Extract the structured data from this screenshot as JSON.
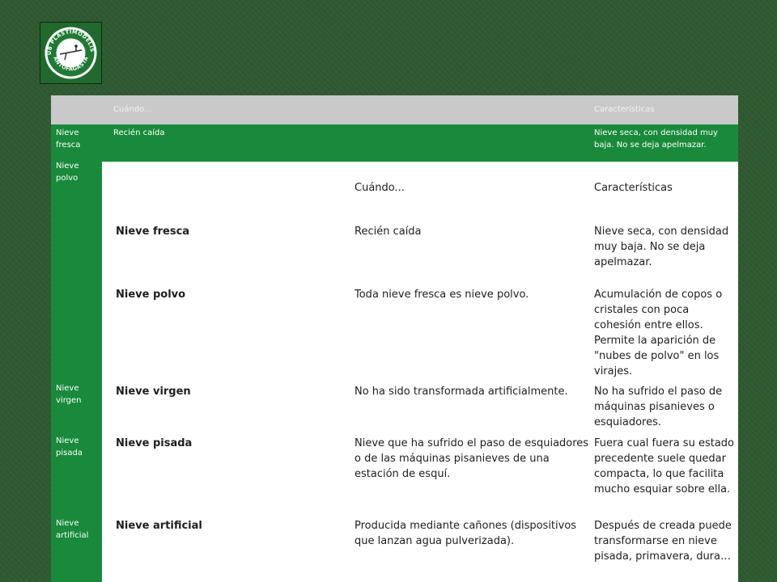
{
  "logo": {
    "text_top": "CLUB PLASTIMODELISMO",
    "text_bottom": "ANTOFAGASTA"
  },
  "header": {
    "col_when": "Cuándo...",
    "col_chars": "Características"
  },
  "ghost_rows": [
    {
      "name": "Nieve fresca",
      "when": "Recién caída",
      "chars": "Nieve seca, con densidad muy baja. No se deja apelmazar."
    },
    {
      "name": "Nieve polvo"
    },
    {
      "name": "Nieve virgen"
    },
    {
      "name": "Nieve pisada"
    },
    {
      "name": "Nieve artificial"
    }
  ],
  "rows": [
    {
      "name": "Nieve fresca",
      "when": "Recién caída",
      "chars": "Nieve seca, con densidad muy baja. No se deja apelmazar."
    },
    {
      "name": "Nieve polvo",
      "when": "Toda nieve fresca es nieve polvo.",
      "chars": "Acumulación de copos o cristales con poca cohesión entre ellos. Permite la aparición de \"nubes de polvo\" en los virajes."
    },
    {
      "name": "Nieve virgen",
      "when": "No ha sido transformada artificialmente.",
      "chars": "No ha sufrido el paso de máquinas pisanieves o esquiadores."
    },
    {
      "name": "Nieve pisada",
      "when": "Nieve que ha sufrido el paso de esquiadores o de las máquinas pisanieves de una estación de esquí.",
      "chars": "Fuera cual fuera su estado precedente suele quedar compacta, lo que facilita mucho esquiar sobre ella."
    },
    {
      "name": "Nieve artificial",
      "when": "Producida mediante cañones (dispositivos que lanzan agua pulverizada).",
      "chars": "Después de creada puede transformarse en nieve pisada, primavera, dura…"
    }
  ]
}
